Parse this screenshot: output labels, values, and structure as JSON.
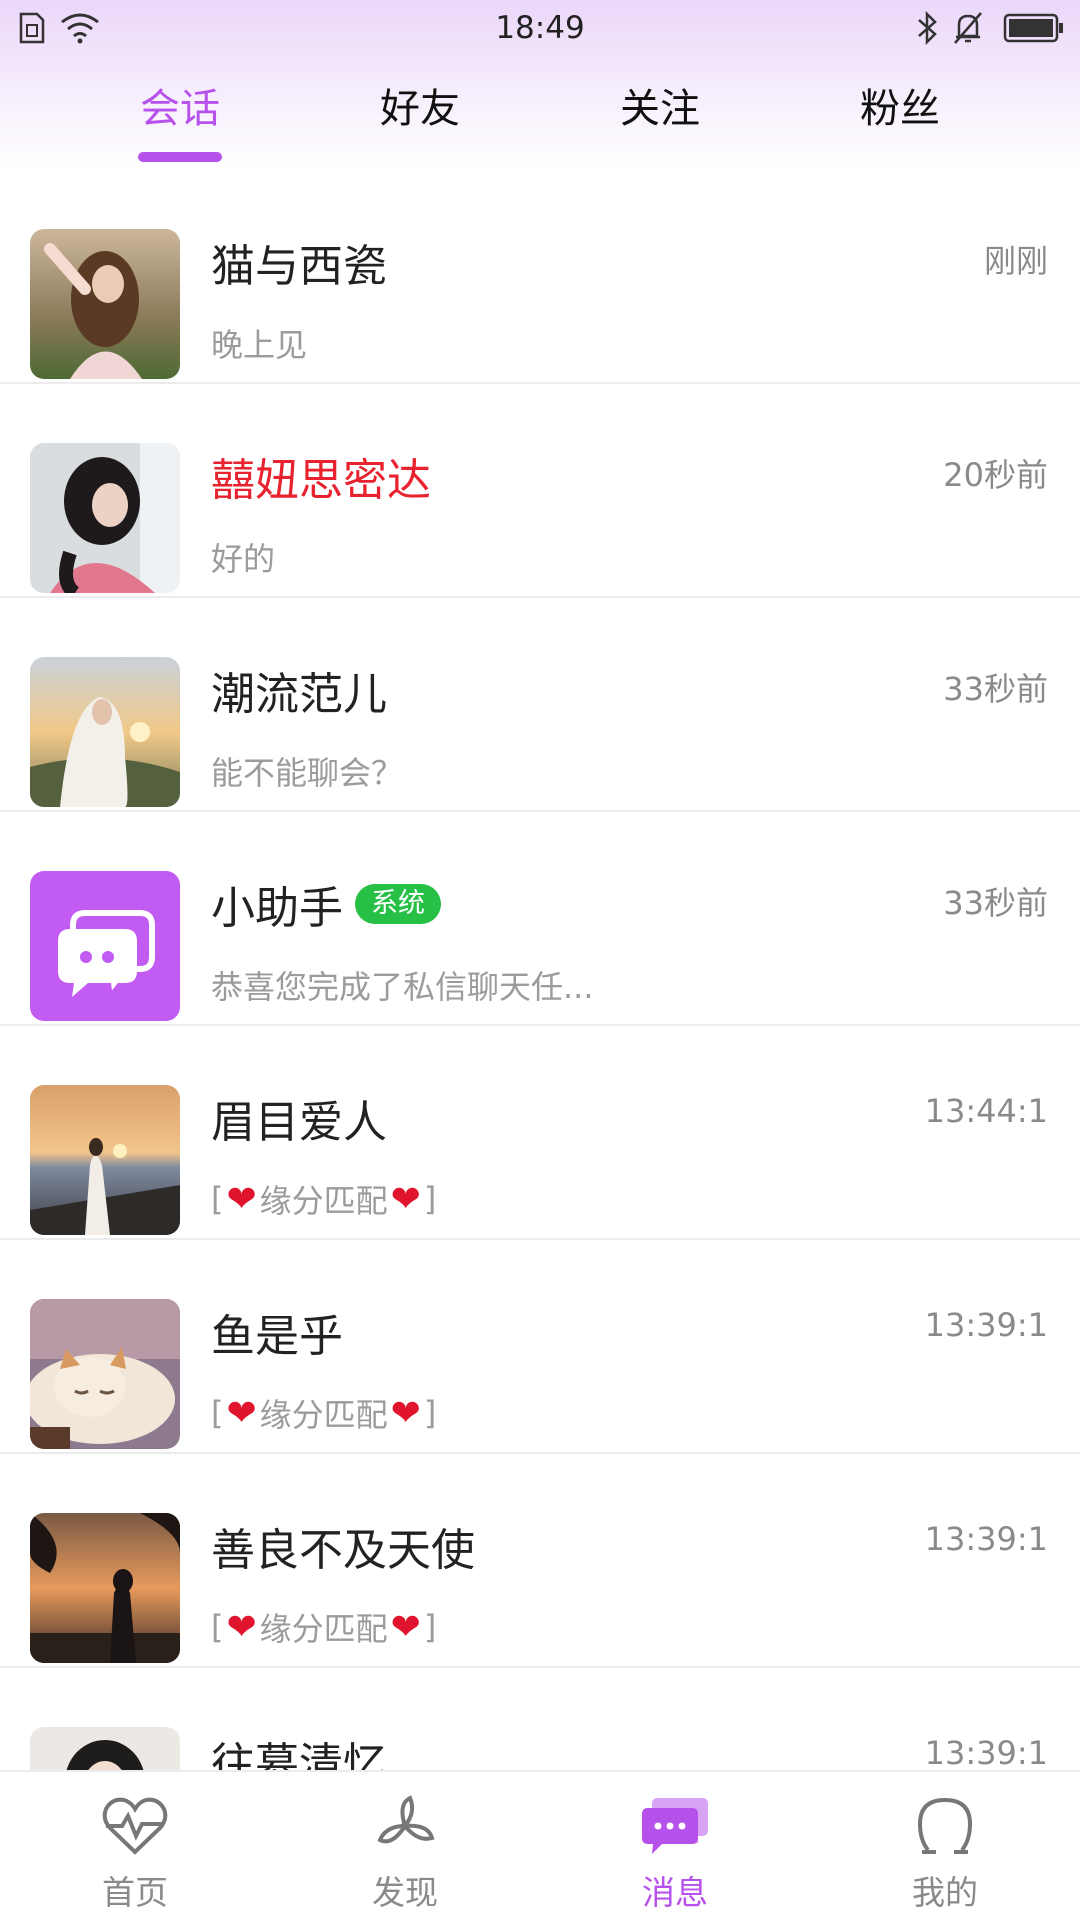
{
  "status_bar": {
    "time": "18:49"
  },
  "tabs": [
    {
      "label": "会话",
      "active": true
    },
    {
      "label": "好友",
      "active": false
    },
    {
      "label": "关注",
      "active": false
    },
    {
      "label": "粉丝",
      "active": false
    }
  ],
  "conversations": [
    {
      "name": "猫与西瓷",
      "time": "刚刚",
      "preview": "晚上见"
    },
    {
      "name": "囍妞思密达",
      "time": "20秒前",
      "preview": "好的",
      "name_color": "#e8232f"
    },
    {
      "name": "潮流范儿",
      "time": "33秒前",
      "preview": "能不能聊会？"
    },
    {
      "name": "小助手",
      "badge": "系统",
      "time": "33秒前",
      "preview": "恭喜您完成了私信聊天任..."
    },
    {
      "name": "眉目爱人",
      "time": "13:44:1",
      "preview_open": "[",
      "preview_text": "缘分匹配",
      "preview_close": "]"
    },
    {
      "name": "鱼是乎",
      "time": "13:39:1",
      "preview_open": "[",
      "preview_text": "缘分匹配",
      "preview_close": "]"
    },
    {
      "name": "善良不及天使",
      "time": "13:39:1",
      "preview_open": "[",
      "preview_text": "缘分匹配",
      "preview_close": "]"
    },
    {
      "name": "往慕清忆",
      "time": "13:39:1"
    }
  ],
  "bottom_nav": [
    {
      "label": "首页",
      "icon": "heartbeat-icon",
      "active": false
    },
    {
      "label": "发现",
      "icon": "pinwheel-icon",
      "active": false
    },
    {
      "label": "消息",
      "icon": "chat-icon",
      "active": true
    },
    {
      "label": "我的",
      "icon": "user-icon",
      "active": false
    }
  ],
  "colors": {
    "accent": "#b751ec",
    "system_badge": "#27c046",
    "highlight_name": "#e8232f",
    "heart": "#e0142c"
  }
}
